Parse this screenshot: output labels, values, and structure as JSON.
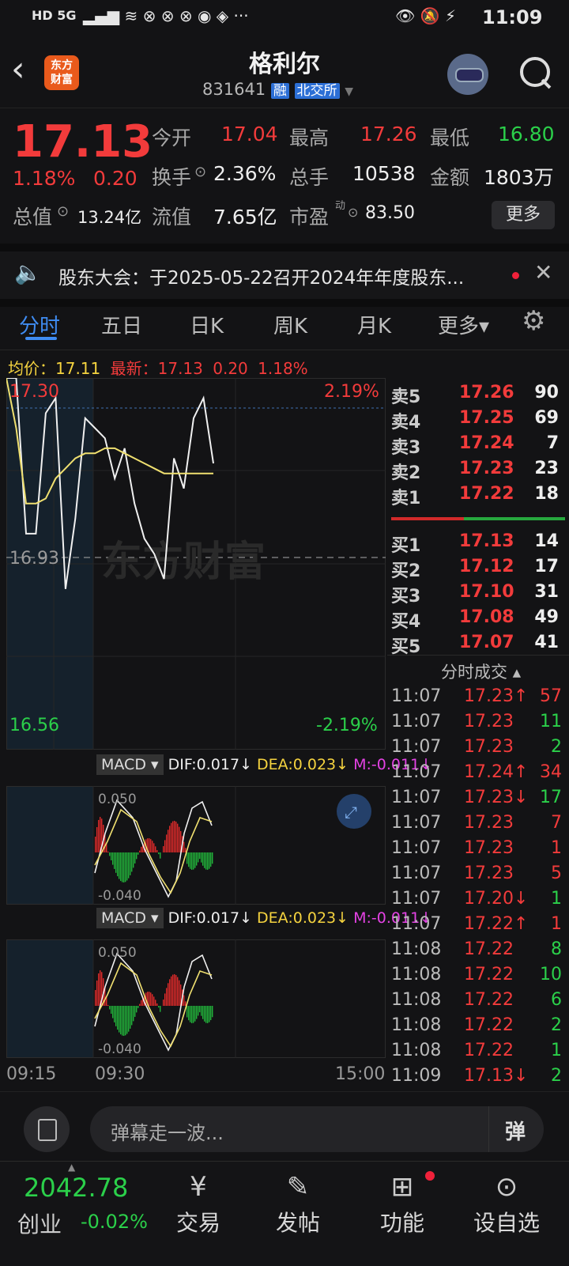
{
  "status_bar": {
    "left": "HD 5G",
    "time": "11:09"
  },
  "header": {
    "title": "格利尔",
    "code": "831641",
    "tag_margin": "融",
    "tag_exchange": "北交所",
    "logo_line1": "东方",
    "logo_line2": "财富"
  },
  "quote": {
    "price": "17.13",
    "change_pct": "1.18%",
    "change_amt": "0.20",
    "open_label": "今开",
    "open": "17.04",
    "high_label": "最高",
    "high": "17.26",
    "low_label": "最低",
    "low": "16.80",
    "turnover_label": "换手",
    "turnover": "2.36%",
    "volume_label": "总手",
    "volume": "10538",
    "amount_label": "金额",
    "amount": "1803万",
    "mktcap_label": "总值",
    "mktcap": "13.24亿",
    "float_label": "流值",
    "float": "7.65亿",
    "pe_label": "市盈",
    "pe_sup": "动",
    "pe": "83.50",
    "more_label": "更多"
  },
  "notice": {
    "text": "股东大会：于2025-05-22召开2024年年度股东..."
  },
  "tabs": [
    "分时",
    "五日",
    "日K",
    "周K",
    "月K",
    "更多▾"
  ],
  "chart_info": {
    "avg_label": "均价：",
    "avg": "17.11",
    "latest_label": "最新：",
    "latest": "17.13",
    "chg": "0.20",
    "pct": "1.18%"
  },
  "chart_data": [
    {
      "type": "line",
      "title": "",
      "y_top": "17.30",
      "y_bottom": "16.56",
      "y_mid": "16.93",
      "pct_top": "2.19%",
      "pct_bottom": "-2.19%",
      "watermark": "东方财富",
      "series": [
        {
          "values": [
            17.3,
            17.3,
            16.99,
            16.99,
            17.23,
            17.26,
            16.88,
            17.02,
            17.22,
            17.2,
            17.18,
            17.1,
            17.16,
            17.05,
            16.98,
            16.95,
            16.9,
            17.14,
            17.08,
            17.22,
            17.26,
            17.13
          ]
        },
        {
          "values": [
            17.3,
            17.2,
            17.05,
            17.05,
            17.06,
            17.1,
            17.12,
            17.14,
            17.15,
            17.15,
            17.16,
            17.16,
            17.15,
            17.14,
            17.13,
            17.12,
            17.11,
            17.11,
            17.11,
            17.11,
            17.11,
            17.11
          ]
        }
      ]
    },
    {
      "type": "bar",
      "title": "MACD",
      "dif": "DIF:0.017",
      "dea": "DEA:0.023",
      "m": "M:-0.011",
      "y_top": "0.050",
      "y_bottom": "-0.040",
      "x_ticks": [
        "09:15",
        "09:30",
        "15:00"
      ]
    }
  ],
  "orderbook": {
    "asks": [
      {
        "label": "卖5",
        "price": "17.26",
        "qty": "90"
      },
      {
        "label": "卖4",
        "price": "17.25",
        "qty": "69"
      },
      {
        "label": "卖3",
        "price": "17.24",
        "qty": "7"
      },
      {
        "label": "卖2",
        "price": "17.23",
        "qty": "23"
      },
      {
        "label": "卖1",
        "price": "17.22",
        "qty": "18"
      }
    ],
    "bids": [
      {
        "label": "买1",
        "price": "17.13",
        "qty": "14"
      },
      {
        "label": "买2",
        "price": "17.12",
        "qty": "17"
      },
      {
        "label": "买3",
        "price": "17.10",
        "qty": "31"
      },
      {
        "label": "买4",
        "price": "17.08",
        "qty": "49"
      },
      {
        "label": "买5",
        "price": "17.07",
        "qty": "41"
      }
    ]
  },
  "trades": {
    "title": "分时成交 ▴",
    "rows": [
      {
        "t": "11:07",
        "p": "17.23↑",
        "q": "57",
        "pc": "red",
        "qc": "red"
      },
      {
        "t": "11:07",
        "p": "17.23",
        "q": "11",
        "pc": "red",
        "qc": "green"
      },
      {
        "t": "11:07",
        "p": "17.23",
        "q": "2",
        "pc": "red",
        "qc": "green"
      },
      {
        "t": "11:07",
        "p": "17.24↑",
        "q": "34",
        "pc": "red",
        "qc": "red"
      },
      {
        "t": "11:07",
        "p": "17.23↓",
        "q": "17",
        "pc": "red",
        "qc": "green"
      },
      {
        "t": "11:07",
        "p": "17.23",
        "q": "7",
        "pc": "red",
        "qc": "red"
      },
      {
        "t": "11:07",
        "p": "17.23",
        "q": "1",
        "pc": "red",
        "qc": "red"
      },
      {
        "t": "11:07",
        "p": "17.23",
        "q": "5",
        "pc": "red",
        "qc": "red"
      },
      {
        "t": "11:07",
        "p": "17.20↓",
        "q": "1",
        "pc": "red",
        "qc": "green"
      },
      {
        "t": "11:07",
        "p": "17.22↑",
        "q": "1",
        "pc": "red",
        "qc": "red"
      },
      {
        "t": "11:08",
        "p": "17.22",
        "q": "8",
        "pc": "red",
        "qc": "green"
      },
      {
        "t": "11:08",
        "p": "17.22",
        "q": "10",
        "pc": "red",
        "qc": "green"
      },
      {
        "t": "11:08",
        "p": "17.22",
        "q": "6",
        "pc": "red",
        "qc": "green"
      },
      {
        "t": "11:08",
        "p": "17.22",
        "q": "2",
        "pc": "red",
        "qc": "green"
      },
      {
        "t": "11:08",
        "p": "17.22",
        "q": "1",
        "pc": "red",
        "qc": "green"
      },
      {
        "t": "11:09",
        "p": "17.13↓",
        "q": "2",
        "pc": "red",
        "qc": "green"
      }
    ]
  },
  "comment": {
    "placeholder": "弹幕走一波...",
    "danmu_icon": "弹"
  },
  "bottom_nav": {
    "index_value": "2042.78",
    "index_name": "创业",
    "index_pct": "-0.02%",
    "items": [
      "交易",
      "发帖",
      "功能",
      "设自选"
    ]
  }
}
